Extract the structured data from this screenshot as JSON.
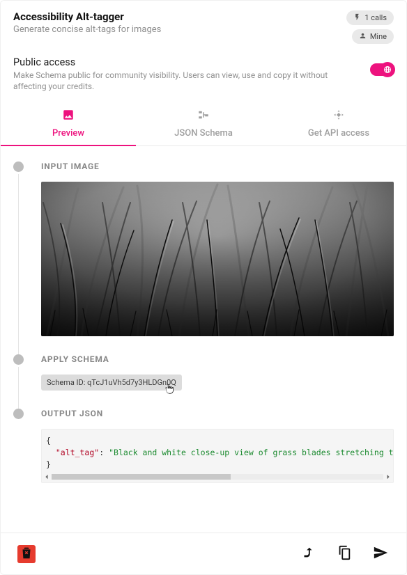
{
  "header": {
    "title": "Accessibility Alt-tagger",
    "subtitle": "Generate concise alt-tags for images",
    "calls_badge": "1 calls",
    "mine_badge": "Mine"
  },
  "public_access": {
    "title": "Public access",
    "description": "Make Schema public for community visibility. Users can view, use and copy it without affecting your credits.",
    "enabled": true
  },
  "tabs": {
    "preview": "Preview",
    "json_schema": "JSON Schema",
    "get_api": "Get API access",
    "active": "preview"
  },
  "steps": {
    "input_image": {
      "label": "INPUT IMAGE"
    },
    "apply_schema": {
      "label": "APPLY SCHEMA",
      "chip_prefix": "Schema ID: ",
      "chip_id": "qTcJ1uVh5d7y3HLDGn0Q"
    },
    "output_json": {
      "label": "OUTPUT JSON",
      "key": "alt_tag",
      "value": "Black and white close-up view of grass blades stretching toward the camera with soft blurred background"
    }
  },
  "chart_data": null
}
